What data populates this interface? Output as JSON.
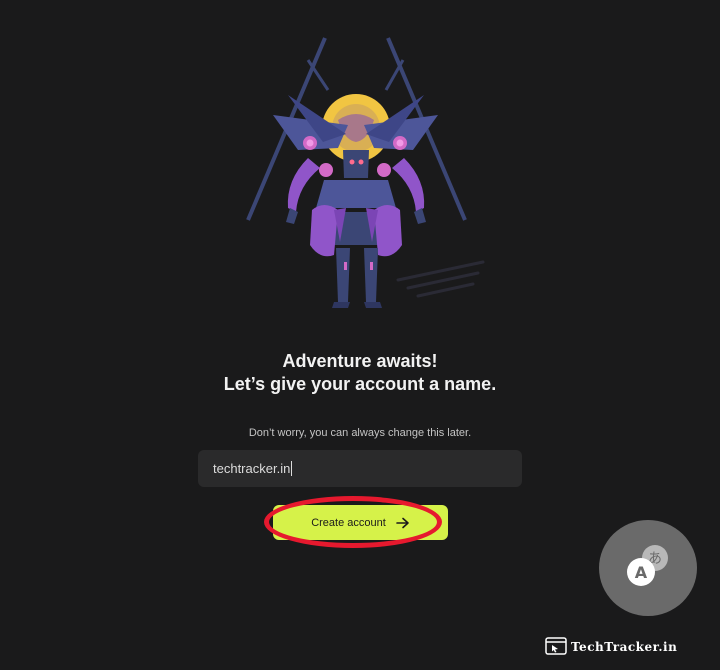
{
  "onboarding": {
    "title_line1": "Adventure awaits!",
    "title_line2": "Let’s give your account a name.",
    "subtitle": "Don’t worry, you can always change this later.",
    "name_input_value": "techtracker.in",
    "create_button_label": "Create account",
    "accent_color": "#d6f249",
    "highlight_color": "#e6192e"
  },
  "icons": {
    "create_button_icon": "arrow-right-icon",
    "fab_icon": "translate-icon",
    "watermark_icon": "browser-window-icon"
  },
  "watermark": {
    "text": "TechTracker.in"
  }
}
